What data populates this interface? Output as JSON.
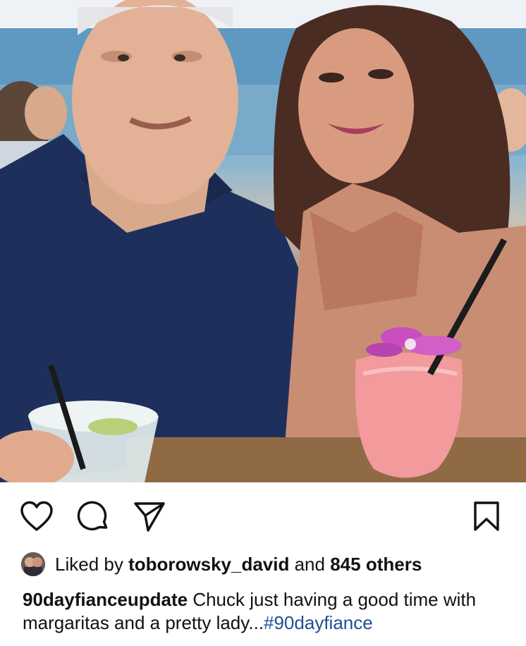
{
  "post": {
    "photo_description_icon": "photo",
    "liked_by_prefix": "Liked by",
    "liked_by_user": "toborowsky_david",
    "liked_by_joiner": "and",
    "liked_by_others": "845 others",
    "caption_user": "90dayfianceupdate",
    "caption_text": " Chuck just having a good time with margaritas and a pretty lady...",
    "caption_hashtag": "#90dayfiance"
  },
  "icons": {
    "like": "heart-icon",
    "comment": "comment-icon",
    "share": "send-icon",
    "save": "bookmark-icon"
  }
}
